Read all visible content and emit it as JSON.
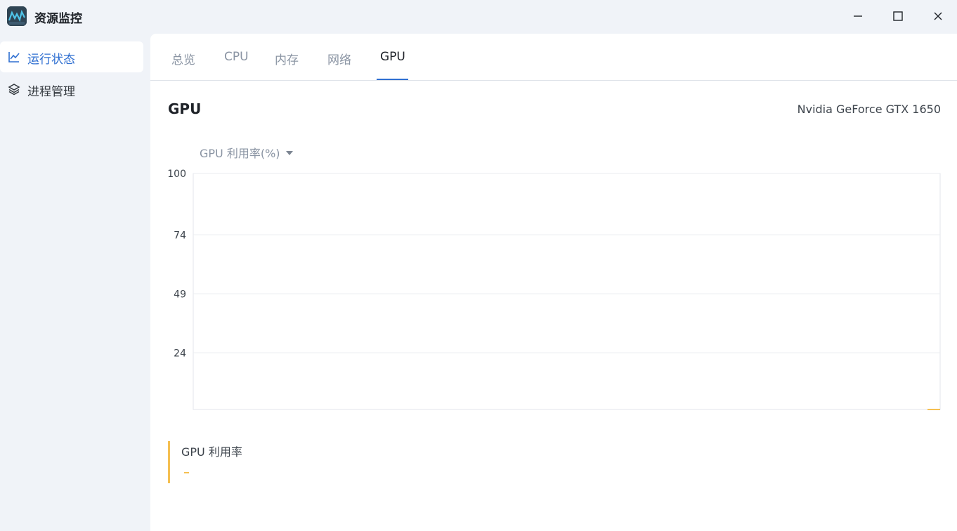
{
  "app": {
    "title": "资源监控"
  },
  "window_controls": {
    "minimize": "minimize",
    "maximize": "maximize",
    "close": "close"
  },
  "sidebar": {
    "items": [
      {
        "label": "运行状态",
        "icon": "line-chart-icon",
        "active": true
      },
      {
        "label": "进程管理",
        "icon": "layers-icon",
        "active": false
      }
    ]
  },
  "tabs": [
    {
      "label": "总览"
    },
    {
      "label": "CPU"
    },
    {
      "label": "内存"
    },
    {
      "label": "网络"
    },
    {
      "label": "GPU",
      "active": true
    }
  ],
  "gpu": {
    "title": "GPU",
    "model": "Nvidia GeForce GTX 1650",
    "metric_select": "GPU 利用率(%)"
  },
  "chart_data": {
    "type": "line",
    "yticks": [
      "100",
      "74",
      "49",
      "24"
    ],
    "ylim": [
      0,
      100
    ],
    "series": [
      {
        "values": [
          0
        ]
      }
    ],
    "grid": true,
    "color": "#f5c052"
  },
  "legend": {
    "label": "GPU 利用率",
    "value": "-"
  },
  "colors": {
    "accent": "#2f6fd1",
    "series": "#f5c052"
  }
}
